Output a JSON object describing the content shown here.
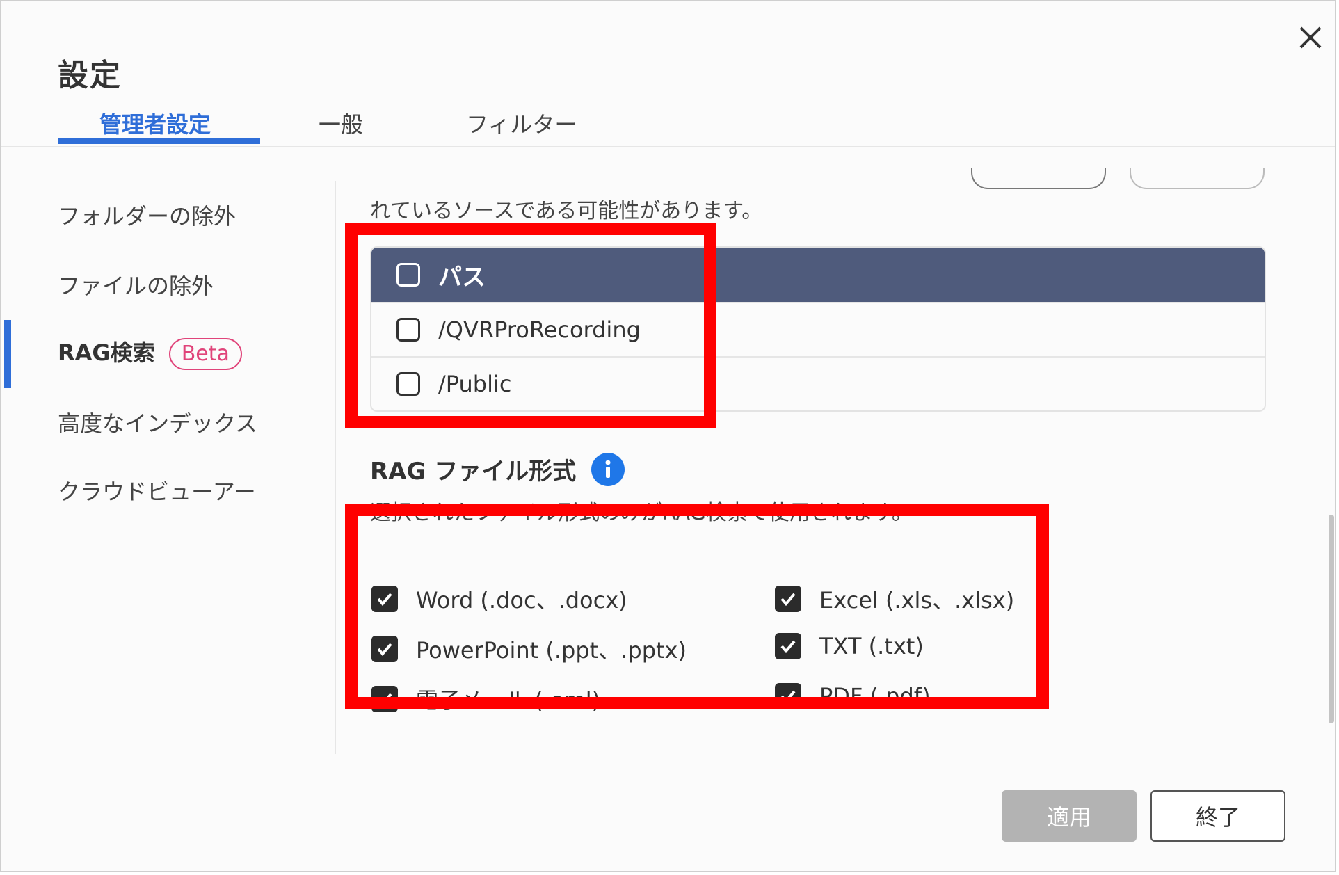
{
  "dialog": {
    "title": "設定",
    "tabs": [
      {
        "label": "管理者設定",
        "active": true
      },
      {
        "label": "一般",
        "active": false
      },
      {
        "label": "フィルター",
        "active": false
      }
    ]
  },
  "sidebar": {
    "items": [
      {
        "label": "フォルダーの除外",
        "active": false
      },
      {
        "label": "ファイルの除外",
        "active": false
      },
      {
        "label": "RAG検索",
        "active": true,
        "badge": "Beta"
      },
      {
        "label": "高度なインデックス",
        "active": false
      },
      {
        "label": "クラウドビューアー",
        "active": false
      }
    ]
  },
  "content": {
    "cutoff_text": "れているソースである可能性があります。",
    "path_table": {
      "header": "パス",
      "rows": [
        "/QVRProRecording",
        "/Public"
      ]
    },
    "rag_section": {
      "title": "RAG ファイル形式",
      "description": "選択されたファイル形式のみがRAG検索で使用されます。",
      "formats": [
        {
          "label": "Word (.doc、.docx)",
          "checked": true
        },
        {
          "label": "Excel (.xls、.xlsx)",
          "checked": true
        },
        {
          "label": "PowerPoint (.ppt、.pptx)",
          "checked": true
        },
        {
          "label": "TXT (.txt)",
          "checked": true
        },
        {
          "label": "電子メール (.eml)",
          "checked": true
        },
        {
          "label": "PDF (.pdf)",
          "checked": true
        }
      ]
    }
  },
  "footer": {
    "apply_label": "適用",
    "close_label": "終了"
  },
  "colors": {
    "accent": "#2f6ed8",
    "table_header": "#4f5b7c",
    "badge": "#e0447a",
    "highlight": "#ff0000",
    "info": "#1f77e8"
  },
  "icons": {
    "close": "close-icon",
    "info": "info-icon",
    "checkbox_checked": "check-icon"
  }
}
